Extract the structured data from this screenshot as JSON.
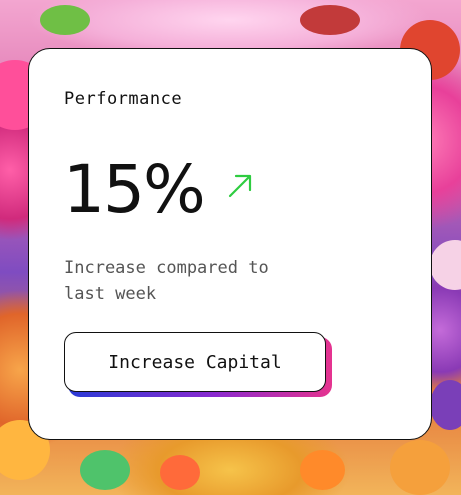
{
  "card": {
    "title": "Performance",
    "metric_value": "15%",
    "trend_icon": "arrow-up-right-icon",
    "trend_color": "#2ecc40",
    "description": "Increase compared to last week",
    "button_label": "Increase Capital"
  },
  "colors": {
    "button_shadow_start": "#2a3bd6",
    "button_shadow_end": "#e5338f"
  }
}
